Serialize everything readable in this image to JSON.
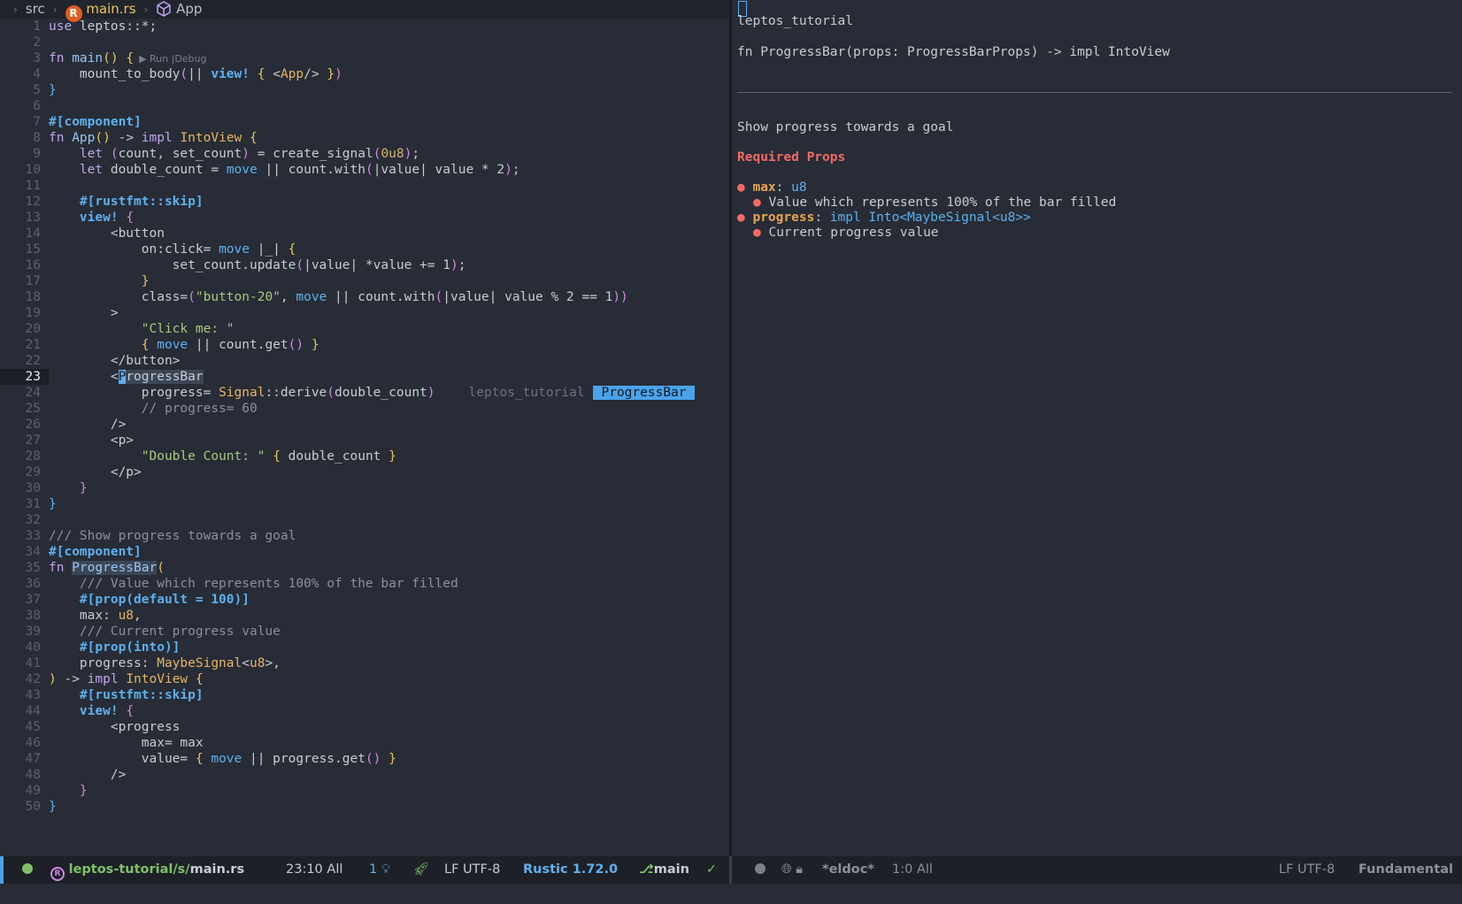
{
  "breadcrumb": {
    "folder": "src",
    "file": "main.rs",
    "symbol": "App"
  },
  "code_lens": "▶ Run |Debug",
  "code_lines": [
    {
      "n": "1",
      "parts": [
        [
          "kw",
          "use"
        ],
        [
          "pn",
          " leptos::*;"
        ]
      ]
    },
    {
      "n": "2",
      "parts": []
    },
    {
      "n": "3",
      "parts": [
        [
          "kw",
          "fn"
        ],
        [
          "pn",
          " "
        ],
        [
          "fn",
          "main"
        ],
        [
          "pr1",
          "()"
        ],
        [
          "pn",
          " "
        ],
        [
          "pr1",
          "{"
        ]
      ],
      "lens": true
    },
    {
      "n": "4",
      "parts": [
        [
          "pn",
          "    mount_to_body"
        ],
        [
          "pr2",
          "("
        ],
        [
          "pn",
          "|| "
        ],
        [
          "a",
          "view!"
        ],
        [
          "pn",
          " "
        ],
        [
          "pr1",
          "{"
        ],
        [
          "pn",
          " <"
        ],
        [
          "ty",
          "App"
        ],
        [
          "pn",
          "/> "
        ],
        [
          "pr1",
          "}"
        ],
        [
          "pr2",
          ")"
        ]
      ]
    },
    {
      "n": "5",
      "parts": [
        [
          "k",
          "}"
        ]
      ]
    },
    {
      "n": "6",
      "parts": []
    },
    {
      "n": "7",
      "parts": [
        [
          "a",
          "#[component]"
        ]
      ]
    },
    {
      "n": "8",
      "parts": [
        [
          "kw",
          "fn"
        ],
        [
          "pn",
          " "
        ],
        [
          "fn",
          "App"
        ],
        [
          "pr1",
          "()"
        ],
        [
          "pn",
          " -> "
        ],
        [
          "kw",
          "impl"
        ],
        [
          "pn",
          " "
        ],
        [
          "ty",
          "IntoView"
        ],
        [
          "pn",
          " "
        ],
        [
          "pr1",
          "{"
        ]
      ]
    },
    {
      "n": "9",
      "parts": [
        [
          "pn",
          "    "
        ],
        [
          "kw",
          "let"
        ],
        [
          "pn",
          " "
        ],
        [
          "pr2",
          "("
        ],
        [
          "pn",
          "count, set_count"
        ],
        [
          "pr2",
          ")"
        ],
        [
          "pn",
          " = create_signal"
        ],
        [
          "pr2",
          "("
        ],
        [
          "num",
          "0u8"
        ],
        [
          "pr2",
          ")"
        ],
        [
          "pn",
          ";"
        ]
      ]
    },
    {
      "n": "10",
      "parts": [
        [
          "pn",
          "    "
        ],
        [
          "kw",
          "let"
        ],
        [
          "pn",
          " double_count = "
        ],
        [
          "k",
          "move"
        ],
        [
          "pn",
          " || count.with"
        ],
        [
          "pr2",
          "("
        ],
        [
          "pn",
          "|value| value * 2"
        ],
        [
          "pr2",
          ")"
        ],
        [
          "pn",
          ";"
        ]
      ]
    },
    {
      "n": "11",
      "parts": []
    },
    {
      "n": "12",
      "parts": [
        [
          "pn",
          "    "
        ],
        [
          "a",
          "#[rustfmt::skip]"
        ]
      ]
    },
    {
      "n": "13",
      "parts": [
        [
          "pn",
          "    "
        ],
        [
          "a",
          "view!"
        ],
        [
          "pn",
          " "
        ],
        [
          "pr2",
          "{"
        ]
      ]
    },
    {
      "n": "14",
      "parts": [
        [
          "pn",
          "        <button"
        ]
      ]
    },
    {
      "n": "15",
      "parts": [
        [
          "pn",
          "            on:click= "
        ],
        [
          "k",
          "move"
        ],
        [
          "pn",
          " |_| "
        ],
        [
          "pr1",
          "{"
        ]
      ]
    },
    {
      "n": "16",
      "parts": [
        [
          "pn",
          "                set_count.update"
        ],
        [
          "pr2",
          "("
        ],
        [
          "pn",
          "|value| *value += 1"
        ],
        [
          "pr2",
          ")"
        ],
        [
          "pn",
          ";"
        ]
      ]
    },
    {
      "n": "17",
      "parts": [
        [
          "pn",
          "            "
        ],
        [
          "pr1",
          "}"
        ]
      ]
    },
    {
      "n": "18",
      "parts": [
        [
          "pn",
          "            class="
        ],
        [
          "pr2",
          "("
        ],
        [
          "s",
          "\"button-20\""
        ],
        [
          "pn",
          ", "
        ],
        [
          "k",
          "move"
        ],
        [
          "pn",
          " || count.with"
        ],
        [
          "pr2",
          "("
        ],
        [
          "pn",
          "|value| value % 2 == 1"
        ],
        [
          "pr2",
          "))"
        ]
      ]
    },
    {
      "n": "19",
      "parts": [
        [
          "pn",
          "        >"
        ]
      ]
    },
    {
      "n": "20",
      "parts": [
        [
          "pn",
          "            "
        ],
        [
          "s",
          "\"Click me: \""
        ]
      ]
    },
    {
      "n": "21",
      "parts": [
        [
          "pn",
          "            "
        ],
        [
          "pr1",
          "{"
        ],
        [
          "pn",
          " "
        ],
        [
          "k",
          "move"
        ],
        [
          "pn",
          " || count.get"
        ],
        [
          "pr2",
          "()"
        ],
        [
          "pn",
          " "
        ],
        [
          "pr1",
          "}"
        ]
      ]
    },
    {
      "n": "22",
      "parts": [
        [
          "pn",
          "        </button>"
        ]
      ]
    },
    {
      "n": "23",
      "parts": [
        [
          "pn",
          "        <"
        ],
        [
          "cursor",
          "P"
        ],
        [
          "hl",
          "rogressBar"
        ]
      ],
      "cur": true
    },
    {
      "n": "24",
      "parts": [
        [
          "pn",
          "            progress= "
        ],
        [
          "ty",
          "Signal"
        ],
        [
          "pn",
          "::derive"
        ],
        [
          "pr2",
          "("
        ],
        [
          "pn",
          "double_count"
        ],
        [
          "pr2",
          ")"
        ]
      ],
      "inline": true
    },
    {
      "n": "25",
      "parts": [
        [
          "c",
          "            // progress= 60"
        ]
      ]
    },
    {
      "n": "26",
      "parts": [
        [
          "pn",
          "        />"
        ]
      ]
    },
    {
      "n": "27",
      "parts": [
        [
          "pn",
          "        <p>"
        ]
      ]
    },
    {
      "n": "28",
      "parts": [
        [
          "pn",
          "            "
        ],
        [
          "s",
          "\"Double Count: \""
        ],
        [
          "pn",
          " "
        ],
        [
          "pr1",
          "{"
        ],
        [
          "pn",
          " double_count "
        ],
        [
          "pr1",
          "}"
        ]
      ]
    },
    {
      "n": "29",
      "parts": [
        [
          "pn",
          "        </p>"
        ]
      ]
    },
    {
      "n": "30",
      "parts": [
        [
          "pn",
          "    "
        ],
        [
          "pr2",
          "}"
        ]
      ]
    },
    {
      "n": "31",
      "parts": [
        [
          "k",
          "}"
        ]
      ]
    },
    {
      "n": "32",
      "parts": []
    },
    {
      "n": "33",
      "parts": [
        [
          "c",
          "/// Show progress towards a goal"
        ]
      ]
    },
    {
      "n": "34",
      "parts": [
        [
          "a",
          "#[component]"
        ]
      ]
    },
    {
      "n": "35",
      "parts": [
        [
          "kw",
          "fn"
        ],
        [
          "pn",
          " "
        ],
        [
          "hlfn",
          "ProgressBar"
        ],
        [
          "pr1",
          "("
        ]
      ]
    },
    {
      "n": "36",
      "parts": [
        [
          "c",
          "    /// Value which represents 100% of the bar filled"
        ]
      ]
    },
    {
      "n": "37",
      "parts": [
        [
          "pn",
          "    "
        ],
        [
          "a",
          "#[prop(default = 100)]"
        ]
      ]
    },
    {
      "n": "38",
      "parts": [
        [
          "pn",
          "    max: "
        ],
        [
          "ty",
          "u8"
        ],
        [
          "pn",
          ","
        ]
      ]
    },
    {
      "n": "39",
      "parts": [
        [
          "c",
          "    /// Current progress value"
        ]
      ]
    },
    {
      "n": "40",
      "parts": [
        [
          "pn",
          "    "
        ],
        [
          "a",
          "#[prop(into)]"
        ]
      ]
    },
    {
      "n": "41",
      "parts": [
        [
          "pn",
          "    progress: "
        ],
        [
          "ty",
          "MaybeSignal"
        ],
        [
          "pn",
          "<"
        ],
        [
          "ty",
          "u8"
        ],
        [
          "pn",
          ">,"
        ]
      ]
    },
    {
      "n": "42",
      "parts": [
        [
          "pr1",
          ")"
        ],
        [
          "pn",
          " -> "
        ],
        [
          "kw",
          "impl"
        ],
        [
          "pn",
          " "
        ],
        [
          "ty",
          "IntoView"
        ],
        [
          "pn",
          " "
        ],
        [
          "pr1",
          "{"
        ]
      ]
    },
    {
      "n": "43",
      "parts": [
        [
          "pn",
          "    "
        ],
        [
          "a",
          "#[rustfmt::skip]"
        ]
      ]
    },
    {
      "n": "44",
      "parts": [
        [
          "pn",
          "    "
        ],
        [
          "a",
          "view!"
        ],
        [
          "pn",
          " "
        ],
        [
          "pr2",
          "{"
        ]
      ]
    },
    {
      "n": "45",
      "parts": [
        [
          "pn",
          "        <progress"
        ]
      ]
    },
    {
      "n": "46",
      "parts": [
        [
          "pn",
          "            max= max"
        ]
      ]
    },
    {
      "n": "47",
      "parts": [
        [
          "pn",
          "            value= "
        ],
        [
          "pr1",
          "{"
        ],
        [
          "pn",
          " "
        ],
        [
          "k",
          "move"
        ],
        [
          "pn",
          " || progress.get"
        ],
        [
          "pr2",
          "()"
        ],
        [
          "pn",
          " "
        ],
        [
          "pr1",
          "}"
        ]
      ]
    },
    {
      "n": "48",
      "parts": [
        [
          "pn",
          "        />"
        ]
      ]
    },
    {
      "n": "49",
      "parts": [
        [
          "pn",
          "    "
        ],
        [
          "pr2",
          "}"
        ]
      ]
    },
    {
      "n": "50",
      "parts": [
        [
          "k",
          "}"
        ]
      ]
    }
  ],
  "inline_hint": {
    "namespace": "leptos_tutorial",
    "tag": "ProgressBar"
  },
  "doc": {
    "crate": "leptos_tutorial",
    "signature": "fn ProgressBar(props: ProgressBarProps) -> impl IntoView",
    "summary": "Show progress towards a goal",
    "required_props_heading": "Required Props",
    "props": [
      {
        "bullet": "●",
        "name": "max",
        "colon": ": ",
        "type": "u8",
        "desc": "Value which represents 100% of the bar filled"
      },
      {
        "bullet": "●",
        "name": "progress",
        "colon": ": ",
        "type": "impl Into<MaybeSignal<u8>>",
        "desc": "Current progress value"
      }
    ]
  },
  "status_left": {
    "project": "leptos-tutorial/s/",
    "file": "main.rs",
    "position": "23:10 All",
    "count": "1",
    "encoding": "LF UTF-8",
    "mode": "Rustic",
    "version": "1.72.0",
    "branch": "main",
    "check": "✓"
  },
  "status_right": {
    "buffer": "*eldoc*",
    "position": "1:0 All",
    "encoding": "LF UTF-8",
    "mode": "Fundamental"
  }
}
